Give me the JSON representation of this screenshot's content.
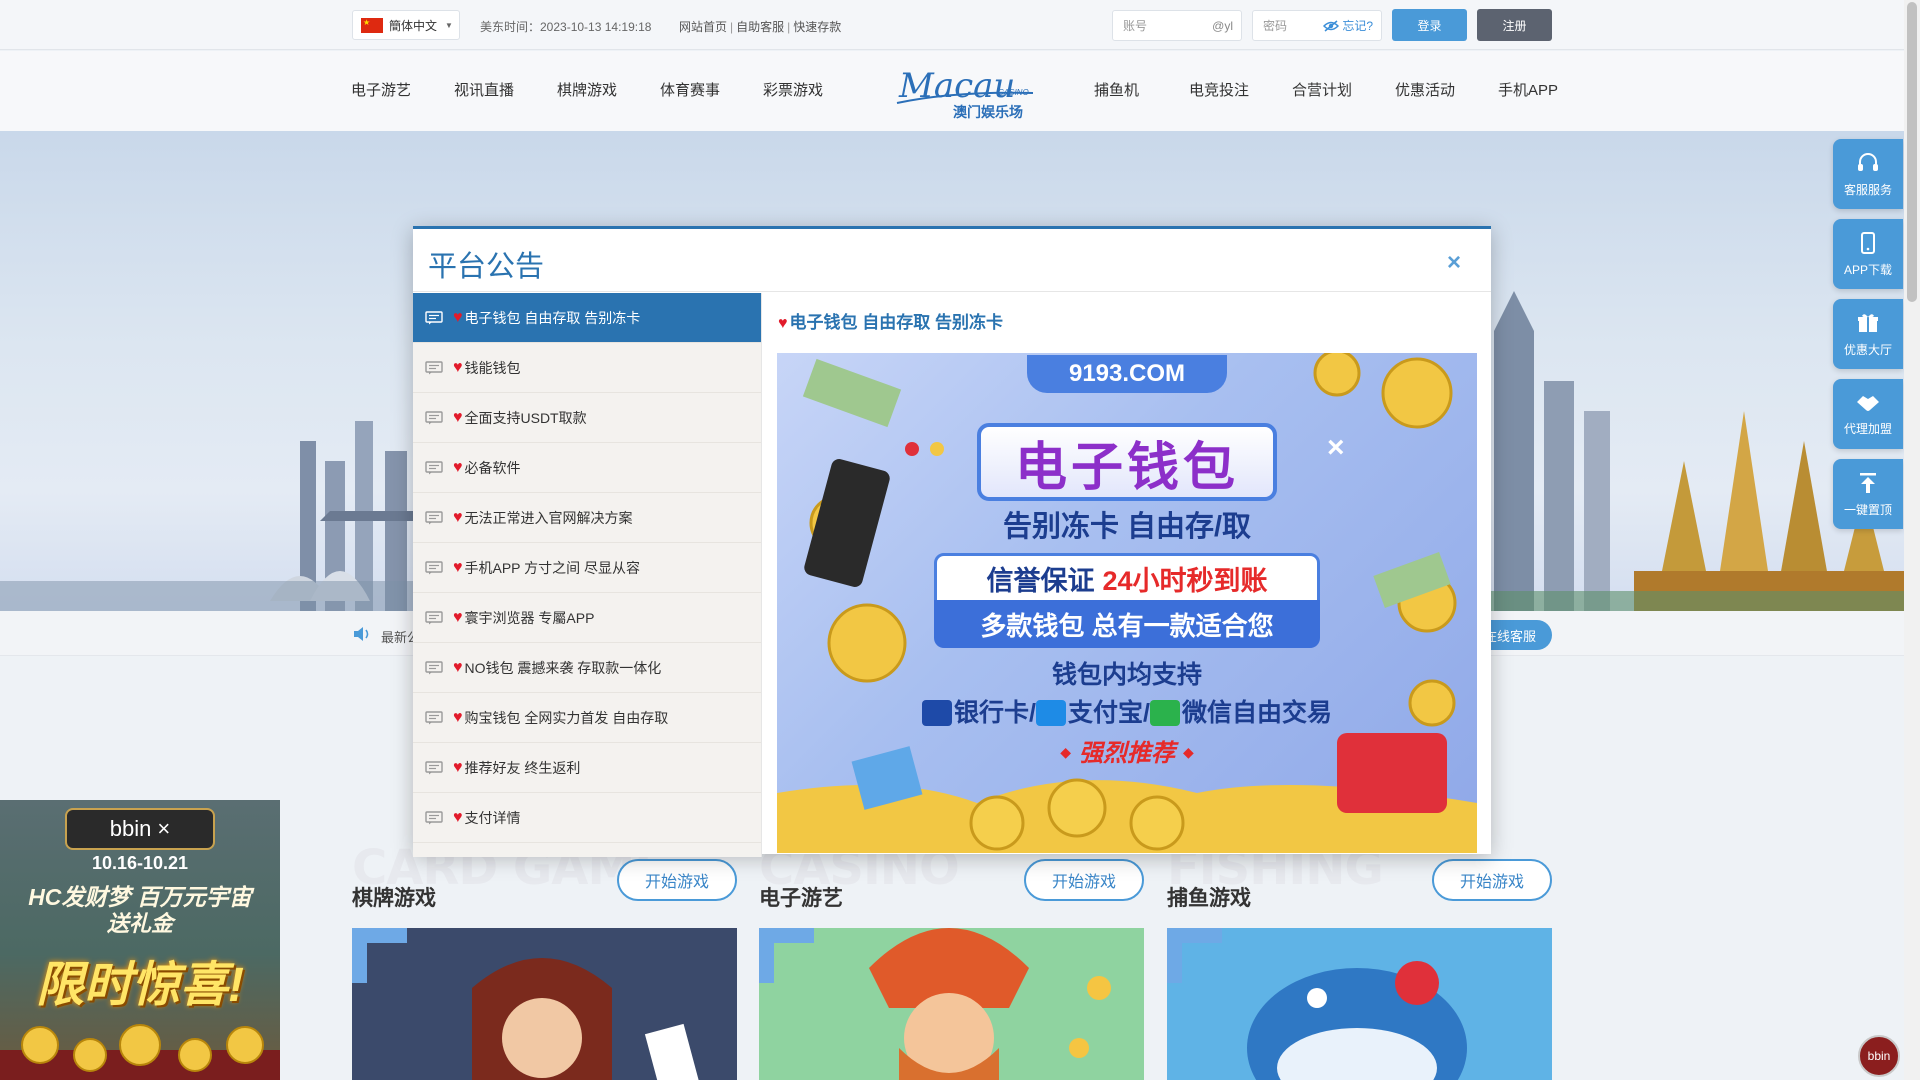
{
  "topbar": {
    "language": "簡体中文",
    "time": "美东时间：2023-10-13 14:19:18",
    "links": [
      "网站首页",
      "自助客服",
      "快速存款"
    ],
    "account_placeholder": "账号",
    "account_suffix": "@yl",
    "password_placeholder": "密码",
    "forgot": "忘记?",
    "login": "登录",
    "register": "注册"
  },
  "nav": {
    "left": [
      "电子游艺",
      "视讯直播",
      "棋牌游戏",
      "体育赛事",
      "彩票游戏"
    ],
    "right": [
      "捕鱼机",
      "电竞投注",
      "合营计划",
      "优惠活动",
      "手机APP"
    ],
    "logo_script": "Macau",
    "logo_casino": "CASINO",
    "logo_cn": "澳门娱乐场"
  },
  "notice": {
    "text": "最新公",
    "online_service": "在线客服"
  },
  "games": [
    {
      "bg": "CARD GAME",
      "title": "棋牌游戏",
      "button": "开始游戏"
    },
    {
      "bg": "CASINO",
      "title": "电子游艺",
      "button": "开始游戏"
    },
    {
      "bg": "FISHING",
      "title": "捕鱼游戏",
      "button": "开始游戏"
    }
  ],
  "promo": {
    "brand": "bbin ×",
    "dates": "10.16-10.21",
    "line1": "HC发财梦 百万元宇宙",
    "line2": "送礼金",
    "big": "限时惊喜!"
  },
  "floating": [
    {
      "label": "客服服务",
      "icon": "headset-icon"
    },
    {
      "label": "APP下载",
      "icon": "phone-icon"
    },
    {
      "label": "优惠大厅",
      "icon": "gift-icon"
    },
    {
      "label": "代理加盟",
      "icon": "handshake-icon"
    },
    {
      "label": "一键置顶",
      "icon": "to-top-icon"
    }
  ],
  "bbin_badge": "bbin",
  "modal": {
    "title": "平台公告",
    "close": "×",
    "items": [
      "电子钱包 自由存取 告别冻卡",
      "钱能钱包",
      "全面支持USDT取款",
      "必备软件",
      "无法正常进入官网解决方案",
      "手机APP 方寸之间 尽显从容",
      "寰宇浏览器 专屬APP",
      "NO钱包 震撼来袭 存取款一体化",
      "购宝钱包 全网实力首发 自由存取",
      "推荐好友 终生返利",
      "支付详情"
    ],
    "active_index": 0,
    "content_title": "电子钱包 自由存取 告别冻卡",
    "poster": {
      "domain": "9193.COM",
      "main": "电子钱包",
      "x": "×",
      "sub": "告别冻卡 自由存/取",
      "box1_a": "信誉保证",
      "box1_b": "24小时秒到账",
      "box2": "多款钱包 总有一款适合您",
      "support": "钱包内均支持",
      "pay_bank": "银行卡",
      "pay_alipay": "支付宝",
      "pay_wechat": "微信",
      "pay_tail": "自由交易",
      "pay_sep": "/",
      "recommend": "强烈推荐"
    }
  }
}
